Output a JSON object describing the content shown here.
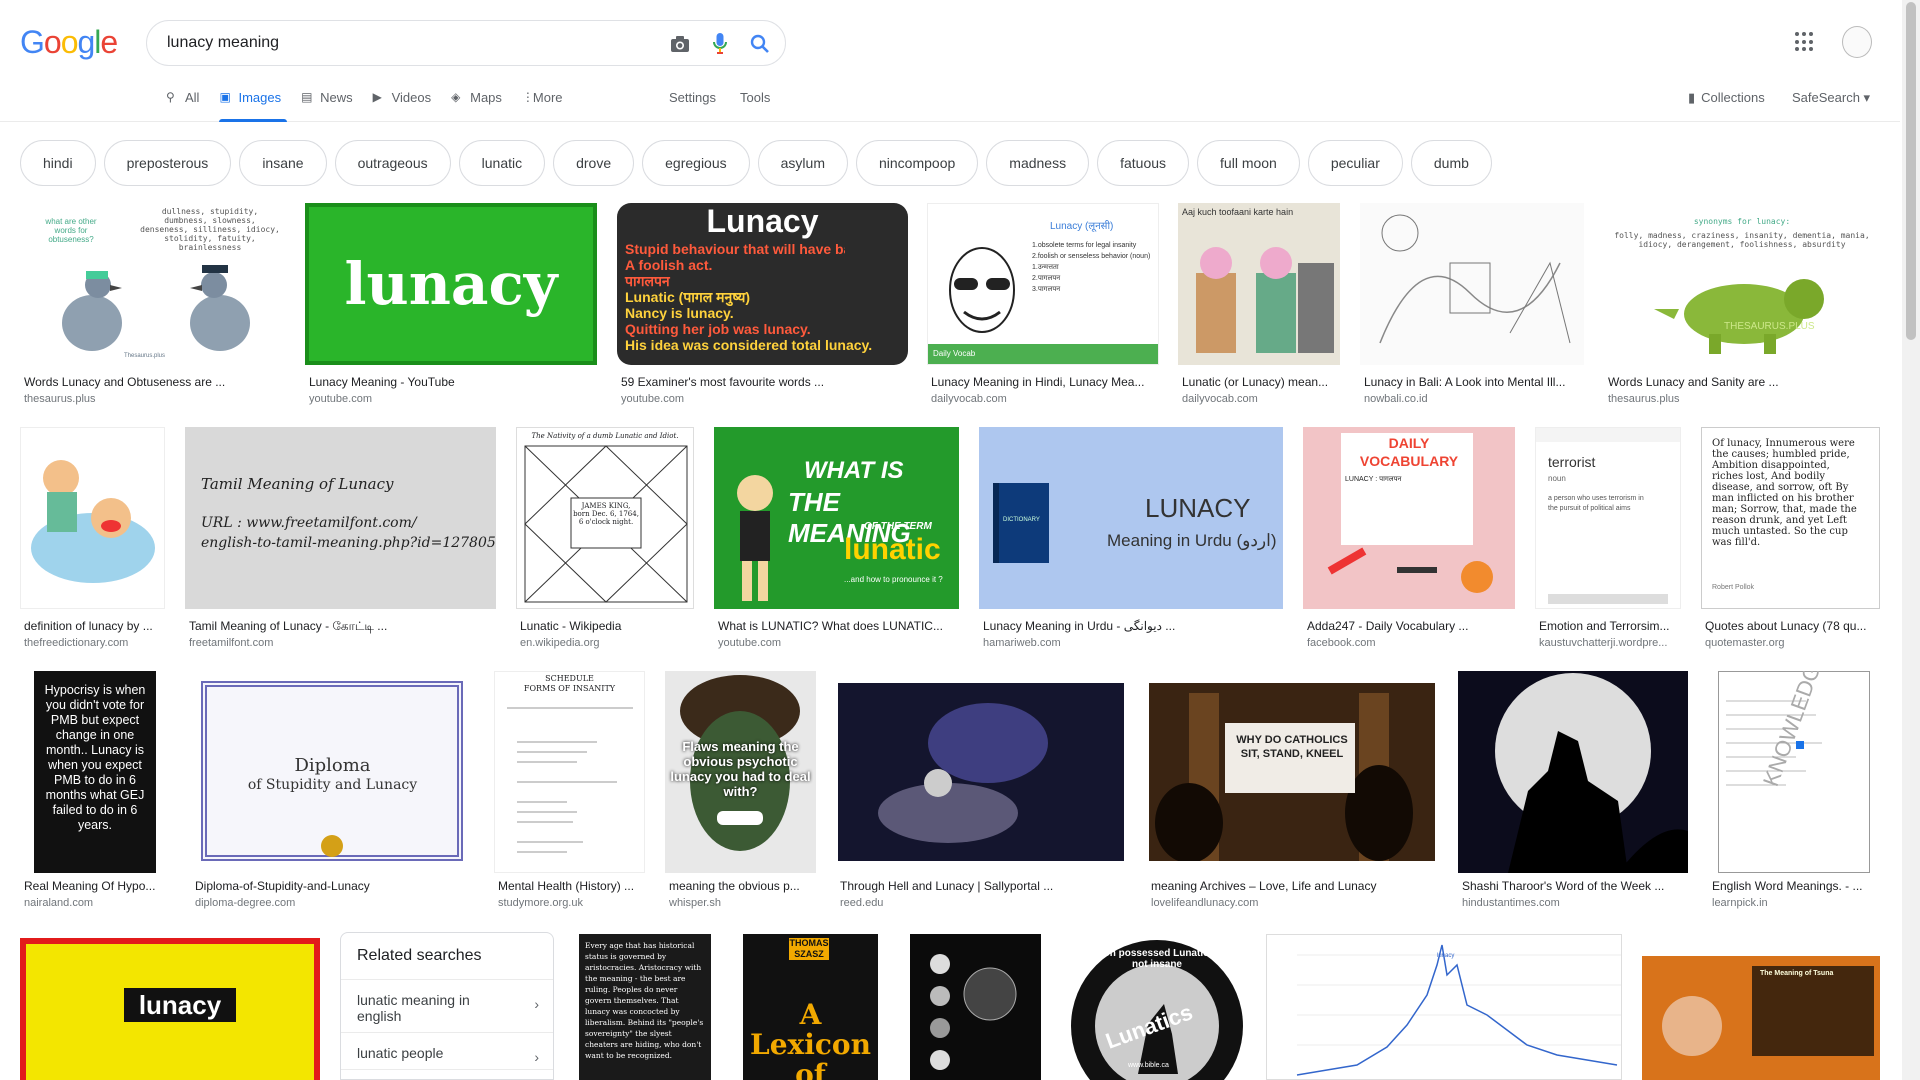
{
  "header": {
    "logo": [
      "G",
      "o",
      "o",
      "g",
      "l",
      "e"
    ],
    "query": "lunacy meaning",
    "icons": [
      "camera-icon",
      "mic-icon",
      "search-icon",
      "apps-icon"
    ]
  },
  "nav": {
    "tabs": [
      {
        "label": "All",
        "icon": "search-icon"
      },
      {
        "label": "Images",
        "icon": "image-icon",
        "active": true
      },
      {
        "label": "News",
        "icon": "news-icon"
      },
      {
        "label": "Videos",
        "icon": "video-icon"
      },
      {
        "label": "Maps",
        "icon": "map-icon"
      },
      {
        "label": "More",
        "icon": "more-vert-icon"
      }
    ],
    "settings": "Settings",
    "tools": "Tools",
    "collections": "Collections",
    "safesearch": "SafeSearch"
  },
  "chips": [
    "hindi",
    "preposterous",
    "insane",
    "outrageous",
    "lunatic",
    "drove",
    "egregious",
    "asylum",
    "nincompoop",
    "madness",
    "fatuous",
    "full moon",
    "peculiar",
    "dumb"
  ],
  "results": [
    {
      "caption": "Words Lunacy and Obtuseness are ...",
      "source": "thesaurus.plus",
      "text": "what are other words for obtuseness?",
      "text2": "dullness, stupidity, dumbness, slowness, denseness, silliness, idiocy, stolidity, fatuity, brainlessness",
      "text3": "Thesaurus.plus"
    },
    {
      "caption": "Lunacy Meaning - YouTube",
      "source": "youtube.com",
      "text": "lunacy"
    },
    {
      "caption": "59 Examiner's most favourite words ...",
      "source": "youtube.com",
      "text": "Lunacy",
      "lines": [
        "Stupid behaviour that will have bad results (N)",
        "A foolish act.",
        "पागलपन",
        "Lunatic (पागल मनुष्य)",
        "Nancy is lunacy.",
        "Quitting her job was lunacy.",
        "His idea was considered total lunacy."
      ]
    },
    {
      "caption": "Lunacy Meaning in Hindi, Lunacy Mea...",
      "source": "dailyvocab.com",
      "text": "Lunacy (लूनसी)",
      "lines": [
        "1.obsolete terms for legal insanity",
        "2.foolish or senseless behavior (noun)",
        "1.उन्मत्तता",
        "2.पागलपन",
        "3.पागलपन"
      ],
      "text3": "Daily Vocab"
    },
    {
      "caption": "Lunatic (or Lunacy) mean...",
      "source": "dailyvocab.com",
      "text": "Aaj kuch toofaani karte hain"
    },
    {
      "caption": "Lunacy in Bali: A Look into Mental Ill...",
      "source": "nowbali.co.id"
    },
    {
      "caption": "Words Lunacy and Sanity are ...",
      "source": "thesaurus.plus",
      "text": "synonyms for lunacy:",
      "text2": "folly, madness, craziness, insanity, dementia, mania, idiocy, derangement, foolishness, absurdity",
      "text3": "THESAURUS.PLUS"
    },
    {
      "caption": "definition of lunacy by ...",
      "source": "thefreedictionary.com"
    },
    {
      "caption": "Tamil Meaning of Lunacy - கோட்டி ...",
      "source": "freetamilfont.com",
      "text": "Tamil Meaning of Lunacy",
      "text2": "URL : www.freetamilfont.com/",
      "text3": "english-to-tamil-meaning.php?id=127805"
    },
    {
      "caption": "Lunatic - Wikipedia",
      "source": "en.wikipedia.org",
      "text": "The Nativity of a dumb Lunatic and Idiot.",
      "text2": "JAMES KING, born Dec. 6, 1764, 6 o'clock night."
    },
    {
      "caption": "What is LUNATIC? What does LUNATIC...",
      "source": "youtube.com",
      "text": "WHAT IS",
      "text2": "THE MEANING",
      "text3": "OF THE TERM",
      "text4": "lunatic",
      "text5": "...and how to pronounce it ?"
    },
    {
      "caption": "Lunacy Meaning in Urdu - دیوانگی ...",
      "source": "hamariweb.com",
      "text": "LUNACY",
      "text2": "Meaning in Urdu (اردو)",
      "text3": "DICTIONARY"
    },
    {
      "caption": "Adda247 - Daily Vocabulary ...",
      "source": "facebook.com",
      "text": "DAILY",
      "text2": "VOCABULARY",
      "text3": "LUNACY : पागलपन"
    },
    {
      "caption": "Emotion and Terrorsim...",
      "source": "kaustuvchatterji.wordpre...",
      "text": "terrorist",
      "text2": "noun",
      "text3": "a person who uses terrorism in the pursuit of political aims"
    },
    {
      "caption": "Quotes about Lunacy (78 qu...",
      "source": "quotemaster.org",
      "text": "Of lunacy, Innumerous were the causes; humbled pride, Ambition disappointed, riches lost, And bodily disease, and sorrow, oft By man inflicted on his brother man; Sorrow, that, made the reason drunk, and yet Left much untasted. So the cup was fill'd.",
      "text2": "Robert Pollok"
    },
    {
      "caption": "Real Meaning Of Hypo...",
      "source": "nairaland.com",
      "text": "Hypocrisy is when you didn't vote for PMB but expect change in one month.. Lunacy is when you expect PMB to do in 6 months what GEJ failed to do in 6 years."
    },
    {
      "caption": "Diploma-of-Stupidity-and-Lunacy",
      "source": "diploma-degree.com",
      "text": "Diploma",
      "text2": "of Stupidity and Lunacy"
    },
    {
      "caption": "Mental Health (History) ...",
      "source": "studymore.org.uk",
      "text": "SCHEDULE",
      "text2": "FORMS OF INSANITY"
    },
    {
      "caption": "meaning the obvious p...",
      "source": "whisper.sh",
      "text": "Flaws meaning the obvious psychotic lunacy you had to deal with?"
    },
    {
      "caption": "Through Hell and Lunacy | Sallyportal ...",
      "source": "reed.edu"
    },
    {
      "caption": "meaning Archives – Love, Life and Lunacy",
      "source": "lovelifeandlunacy.com",
      "text": "WHY DO CATHOLICS SIT, STAND, KNEEL"
    },
    {
      "caption": "Shashi Tharoor's Word of the Week ...",
      "source": "hindustantimes.com"
    },
    {
      "caption": "English Word Meanings. - ...",
      "source": "learnpick.in",
      "text": "KNOWLEDGE College"
    },
    {
      "text": "lunacy"
    },
    {
      "text": "Every age that has historical status is governed by aristocracies. Aristocracy with the meaning - the best are ruling. Peoples do never govern themselves. That lunacy was concocted by liberalism. Behind its \"people's sovereignty\" the slyest cheaters are hiding, who don't want to be recognized."
    },
    {
      "text": "THOMAS SZASZ",
      "text2": "A Lexicon of Lunacy"
    },
    {
      "text": ""
    },
    {
      "text": "Demon possessed Lunatics are not insane",
      "text2": "Lunatics",
      "text3": "www.bible.ca"
    },
    {
      "text": "lunacy"
    },
    {
      "text": "The Meaning of Tsuna"
    }
  ],
  "related": {
    "title": "Related searches",
    "items": [
      "lunatic meaning in english",
      "lunatic people"
    ]
  },
  "colors": {
    "accent": "#1a73e8"
  }
}
